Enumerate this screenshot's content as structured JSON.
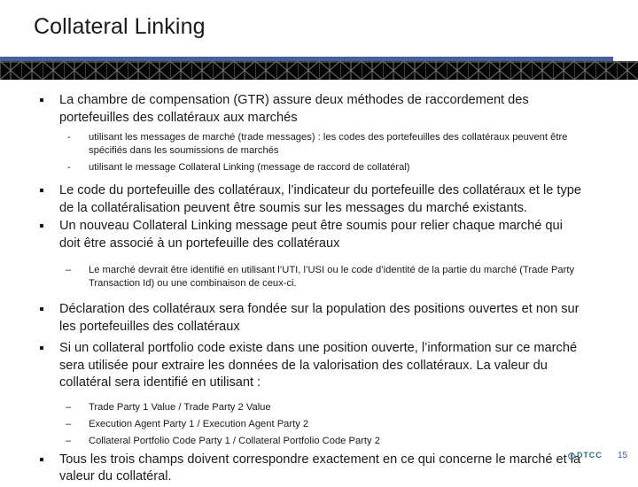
{
  "slide": {
    "title": "Collateral Linking",
    "bullets": [
      {
        "level": 1,
        "marker": "square",
        "text": "La chambre de compensation (GTR) assure deux méthodes de raccordement des portefeuilles des collatéraux aux marchés"
      },
      {
        "level": 2,
        "marker": "-",
        "text": "utilisant les messages de marché (trade messages) : les codes des portefeuilles des collatéraux peuvent être spécifiés dans les soumissions de marchés"
      },
      {
        "level": 2,
        "marker": "-",
        "text": "utilisant le message Collateral Linking (message de raccord de collatéral)"
      },
      {
        "level": 1,
        "marker": "square",
        "text": "Le code du portefeuille des collatéraux, l’indicateur du portefeuille des collatéraux et le type de la collatéralisation peuvent être soumis sur les messages du marché existants."
      },
      {
        "level": 1,
        "marker": "square",
        "text": "Un nouveau Collateral Linking message peut être soumis pour relier chaque marché qui doit être associé à un portefeuille des collatéraux"
      },
      {
        "level": 3,
        "marker": "–",
        "text": "Le marché devrait être identifié en utilisant l’UTI, l’USI ou le code d’identité de la partie du marché (Trade Party Transaction Id) ou une combinaison de ceux-ci."
      },
      {
        "level": 1,
        "marker": "square",
        "text": "Déclaration des collatéraux sera fondée sur la population des positions ouvertes et non sur les portefeuilles des collatéraux"
      },
      {
        "level": 1,
        "marker": "square",
        "text": "Si un collateral portfolio code existe dans une position ouverte, l’information sur ce marché sera utilisée pour extraire les données de la valorisation des collatéraux. La valeur du collatéral sera identifié en utilisant :"
      },
      {
        "level": 3,
        "marker": "–",
        "text": "Trade Party 1 Value / Trade Party 2 Value"
      },
      {
        "level": 3,
        "marker": "–",
        "text": "Execution Agent Party 1 / Execution Agent Party 2"
      },
      {
        "level": 3,
        "marker": "–",
        "text": "Collateral Portfolio Code Party 1 / Collateral Portfolio Code Party 2"
      },
      {
        "level": 1,
        "marker": "square",
        "text": "Tous les trois champs doivent correspondre exactement en ce qui concerne le marché et la valeur du collatéral."
      }
    ]
  },
  "footer": {
    "logo_text": "DTCC",
    "logo_icon": "dtcc-circle-logo-icon",
    "page_number": "15"
  },
  "colors": {
    "banner_blue": "#48619c",
    "banner_dark": "#050505",
    "lattice_line": "#8a8a8a",
    "title_text": "#1a1a1a",
    "body_text": "#1a1a1a",
    "logo_teal": "#2a6b7c",
    "page_number_color": "#3a5a8c"
  }
}
